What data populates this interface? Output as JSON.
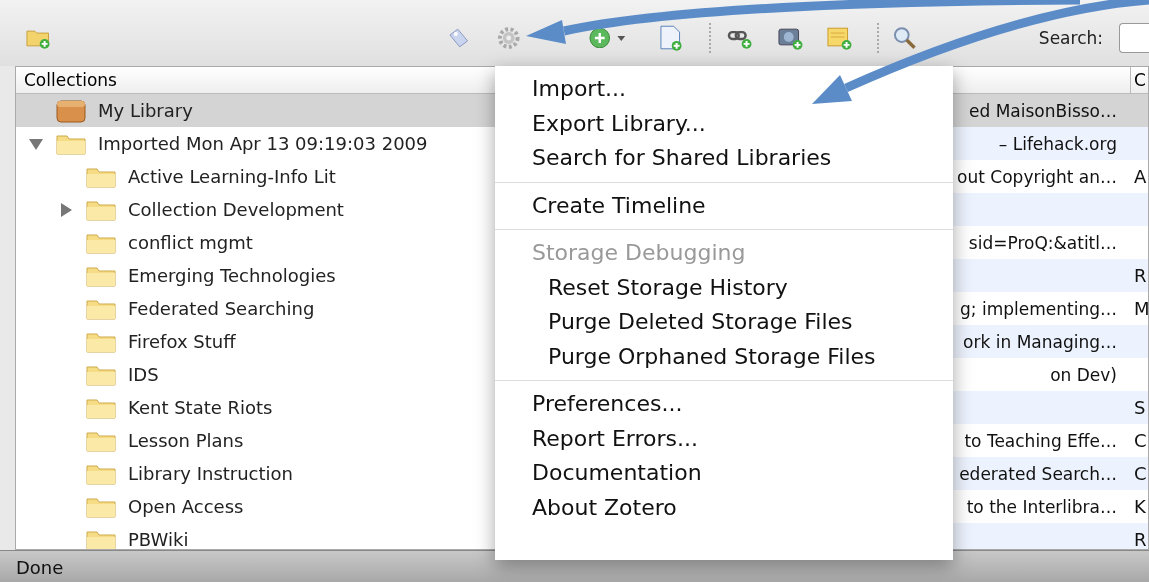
{
  "toolbar": {
    "search_label": "Search:"
  },
  "collections": {
    "header": "Collections",
    "tree": [
      {
        "label": "My Library",
        "kind": "library",
        "selected": true
      },
      {
        "label": "Imported Mon Apr 13 09:19:03 2009",
        "kind": "collection",
        "selected": false,
        "expanded": true,
        "children": [
          {
            "label": "Active Learning-Info Lit",
            "kind": "collection",
            "selected": false
          },
          {
            "label": "Collection Development",
            "kind": "collection",
            "selected": false,
            "expanded": false
          },
          {
            "label": "conflict mgmt",
            "kind": "collection",
            "selected": false
          },
          {
            "label": "Emerging Technologies",
            "kind": "collection",
            "selected": false
          },
          {
            "label": "Federated Searching",
            "kind": "collection",
            "selected": false
          },
          {
            "label": "Firefox Stuff",
            "kind": "collection",
            "selected": false
          },
          {
            "label": "IDS",
            "kind": "collection",
            "selected": false
          },
          {
            "label": "Kent State Riots",
            "kind": "collection",
            "selected": false
          },
          {
            "label": "Lesson Plans",
            "kind": "collection",
            "selected": false
          },
          {
            "label": "Library Instruction",
            "kind": "collection",
            "selected": false
          },
          {
            "label": "Open Access",
            "kind": "collection",
            "selected": false
          },
          {
            "label": "PBWiki",
            "kind": "collection",
            "selected": false
          }
        ]
      }
    ]
  },
  "items": {
    "column_2_header": "C",
    "rows": [
      {
        "title": "ed MaisonBisso…",
        "column_2": "",
        "selected": true
      },
      {
        "title": "– Lifehack.org",
        "column_2": "",
        "selected": false
      },
      {
        "title": "out Copyright an…",
        "column_2": "A",
        "selected": false
      },
      {
        "title": "",
        "column_2": "",
        "selected": false
      },
      {
        "title": "sid=ProQ:&atitl…",
        "column_2": "",
        "selected": false
      },
      {
        "title": "",
        "column_2": "R",
        "selected": false
      },
      {
        "title": "g; implementing…",
        "column_2": "M",
        "selected": false
      },
      {
        "title": "ork in Managing…",
        "column_2": "",
        "selected": false
      },
      {
        "title": "on Dev)",
        "column_2": "",
        "selected": false
      },
      {
        "title": "",
        "column_2": "S",
        "selected": false
      },
      {
        "title": "to Teaching Effe…",
        "column_2": "C",
        "selected": false
      },
      {
        "title": "ederated Search…",
        "column_2": "C",
        "selected": false
      },
      {
        "title": "to the Interlibra…",
        "column_2": "K",
        "selected": false
      },
      {
        "title": "",
        "column_2": "R",
        "selected": false
      }
    ]
  },
  "menu": {
    "items": [
      {
        "kind": "item",
        "label": "Import..."
      },
      {
        "kind": "item",
        "label": "Export Library..."
      },
      {
        "kind": "item",
        "label": "Search for Shared Libraries"
      },
      {
        "kind": "separator"
      },
      {
        "kind": "item",
        "label": "Create Timeline"
      },
      {
        "kind": "separator"
      },
      {
        "kind": "header",
        "label": "Storage Debugging"
      },
      {
        "kind": "subitem",
        "label": "Reset Storage History"
      },
      {
        "kind": "subitem",
        "label": "Purge Deleted Storage Files"
      },
      {
        "kind": "subitem",
        "label": "Purge Orphaned Storage Files"
      },
      {
        "kind": "separator"
      },
      {
        "kind": "item",
        "label": "Preferences..."
      },
      {
        "kind": "item",
        "label": "Report Errors..."
      },
      {
        "kind": "item",
        "label": "Documentation"
      },
      {
        "kind": "item",
        "label": "About Zotero"
      }
    ]
  },
  "status_bar": {
    "text": "Done"
  }
}
